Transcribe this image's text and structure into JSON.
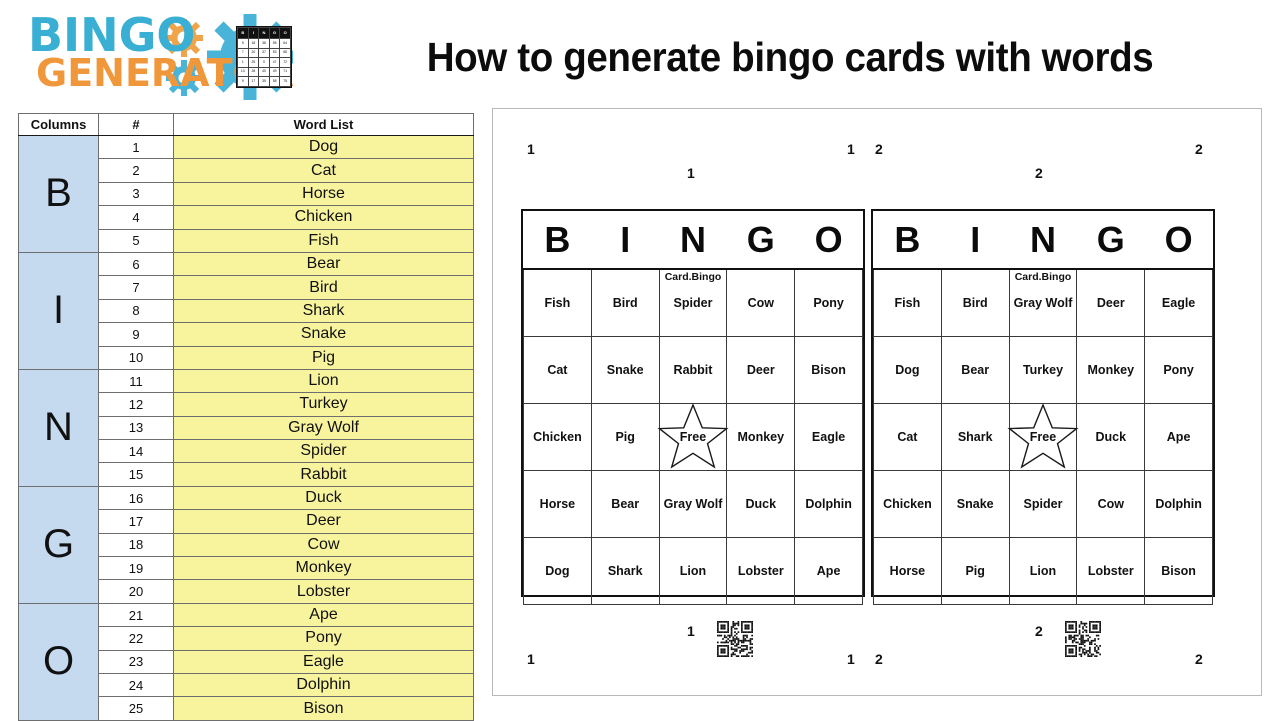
{
  "header": {
    "logo": {
      "line1": "BINGO",
      "line2": "GENERATOR",
      "brand_blue": "#3aafd4",
      "brand_orange": "#f0973c",
      "mini_card_header": [
        "B",
        "I",
        "N",
        "G",
        "O"
      ],
      "mini_card_rows": [
        [
          "5",
          "18",
          "38",
          "55",
          "64"
        ],
        [
          "7",
          "20",
          "37",
          "53",
          "68"
        ],
        [
          "1",
          "25",
          "X",
          "47",
          "72"
        ],
        [
          "13",
          "28",
          "40",
          "49",
          "71"
        ],
        [
          "9",
          "17",
          "35",
          "58",
          "75"
        ]
      ]
    },
    "title": "How to generate bingo cards with words"
  },
  "word_list_table": {
    "columns": [
      "Columns",
      "#",
      "Word List"
    ],
    "groups": [
      {
        "letter": "B",
        "rows": [
          {
            "n": "1",
            "word": "Dog"
          },
          {
            "n": "2",
            "word": "Cat"
          },
          {
            "n": "3",
            "word": "Horse"
          },
          {
            "n": "4",
            "word": "Chicken"
          },
          {
            "n": "5",
            "word": "Fish"
          }
        ]
      },
      {
        "letter": "I",
        "rows": [
          {
            "n": "6",
            "word": "Bear"
          },
          {
            "n": "7",
            "word": "Bird"
          },
          {
            "n": "8",
            "word": "Shark"
          },
          {
            "n": "9",
            "word": "Snake"
          },
          {
            "n": "10",
            "word": "Pig"
          }
        ]
      },
      {
        "letter": "N",
        "rows": [
          {
            "n": "11",
            "word": "Lion"
          },
          {
            "n": "12",
            "word": "Turkey"
          },
          {
            "n": "13",
            "word": "Gray Wolf"
          },
          {
            "n": "14",
            "word": "Spider"
          },
          {
            "n": "15",
            "word": "Rabbit"
          }
        ]
      },
      {
        "letter": "G",
        "rows": [
          {
            "n": "16",
            "word": "Duck"
          },
          {
            "n": "17",
            "word": "Deer"
          },
          {
            "n": "18",
            "word": "Cow"
          },
          {
            "n": "19",
            "word": "Monkey"
          },
          {
            "n": "20",
            "word": "Lobster"
          }
        ]
      },
      {
        "letter": "O",
        "rows": [
          {
            "n": "21",
            "word": "Ape"
          },
          {
            "n": "22",
            "word": "Pony"
          },
          {
            "n": "23",
            "word": "Eagle"
          },
          {
            "n": "24",
            "word": "Dolphin"
          },
          {
            "n": "25",
            "word": "Bison"
          }
        ]
      }
    ],
    "group_fill": "#c5d9ef",
    "word_fill": "#f8f49e"
  },
  "cards_panel": {
    "card_header_letters": [
      "B",
      "I",
      "N",
      "G",
      "O"
    ],
    "card_tag": "Card.Bingo",
    "free_label": "Free",
    "cards": [
      {
        "number": "1",
        "grid": [
          [
            "Fish",
            "Bird",
            "Spider",
            "Cow",
            "Pony"
          ],
          [
            "Cat",
            "Snake",
            "Rabbit",
            "Deer",
            "Bison"
          ],
          [
            "Chicken",
            "Pig",
            "Free",
            "Monkey",
            "Eagle"
          ],
          [
            "Horse",
            "Bear",
            "Gray Wolf",
            "Duck",
            "Dolphin"
          ],
          [
            "Dog",
            "Shark",
            "Lion",
            "Lobster",
            "Ape"
          ]
        ]
      },
      {
        "number": "2",
        "grid": [
          [
            "Fish",
            "Bird",
            "Gray Wolf",
            "Deer",
            "Eagle"
          ],
          [
            "Dog",
            "Bear",
            "Turkey",
            "Monkey",
            "Pony"
          ],
          [
            "Cat",
            "Shark",
            "Free",
            "Duck",
            "Ape"
          ],
          [
            "Chicken",
            "Snake",
            "Spider",
            "Cow",
            "Dolphin"
          ],
          [
            "Horse",
            "Pig",
            "Lion",
            "Lobster",
            "Bison"
          ]
        ]
      }
    ],
    "corner_markers": {
      "top_left_1": "1",
      "top_center_1": "1",
      "top_right_1": "1",
      "top_left_2": "2",
      "top_center_2": "2",
      "top_right_2": "2",
      "bottom_left_1": "1",
      "bottom_center_1": "1",
      "bottom_right_1": "1",
      "bottom_left_2": "2",
      "bottom_center_2": "2",
      "bottom_right_2": "2"
    }
  }
}
